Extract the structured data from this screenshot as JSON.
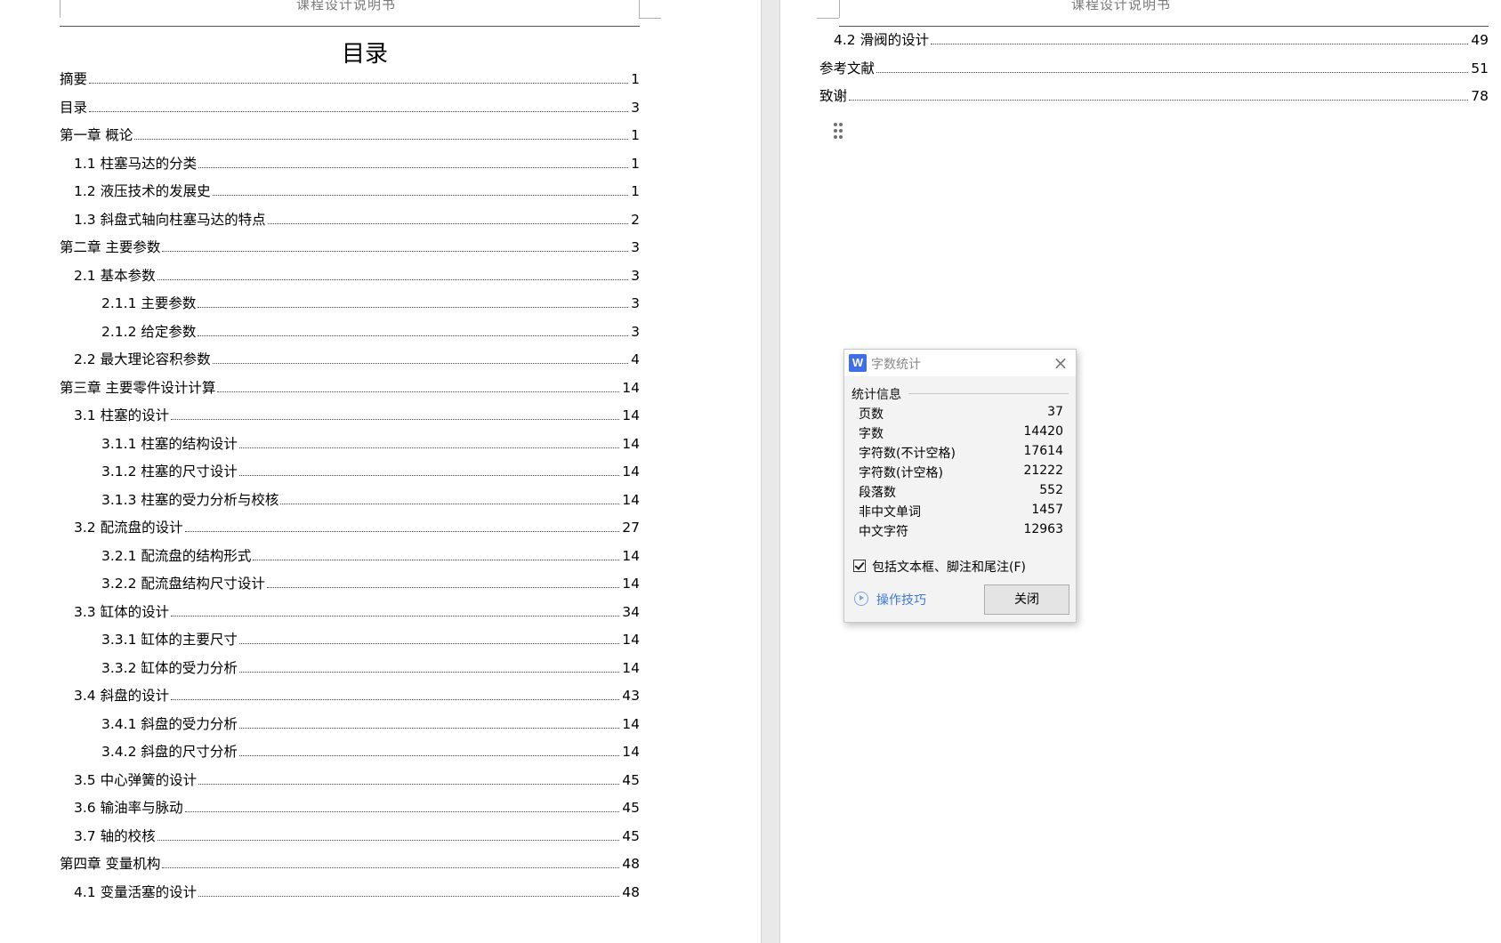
{
  "header": {
    "title": "课程设计说明书"
  },
  "toc": {
    "title": "目录",
    "left_entries": [
      {
        "label": "摘要",
        "page": "1",
        "level": 0
      },
      {
        "label": "目录",
        "page": "3",
        "level": 0
      },
      {
        "label": "第一章  概论",
        "page": "1",
        "level": 0
      },
      {
        "label": "1.1  柱塞马达的分类",
        "page": "1",
        "level": 1
      },
      {
        "label": "1.2  液压技术的发展史",
        "page": "1",
        "level": 1
      },
      {
        "label": "1.3  斜盘式轴向柱塞马达的特点",
        "page": "2",
        "level": 1
      },
      {
        "label": "第二章  主要参数",
        "page": "3",
        "level": 0
      },
      {
        "label": "2.1 基本参数",
        "page": "3",
        "level": 1
      },
      {
        "label": "2.1.1 主要参数",
        "page": "3",
        "level": 2
      },
      {
        "label": "2.1.2 给定参数",
        "page": "3",
        "level": 2
      },
      {
        "label": "2.2 最大理论容积参数",
        "page": "4",
        "level": 1
      },
      {
        "label": "第三章  主要零件设计计算",
        "page": "14",
        "level": 0
      },
      {
        "label": "3.1 柱塞的设计",
        "page": "14",
        "level": 1
      },
      {
        "label": "3.1.1 柱塞的结构设计",
        "page": "14",
        "level": 2
      },
      {
        "label": "3.1.2 柱塞的尺寸设计",
        "page": "14",
        "level": 2
      },
      {
        "label": "3.1.3 柱塞的受力分析与校核",
        "page": "14",
        "level": 2
      },
      {
        "label": "3.2 配流盘的设计",
        "page": "27",
        "level": 1
      },
      {
        "label": "3.2.1 配流盘的结构形式",
        "page": "14",
        "level": 2
      },
      {
        "label": "3.2.2 配流盘结构尺寸设计",
        "page": "14",
        "level": 2
      },
      {
        "label": "3.3 缸体的设计",
        "page": "34",
        "level": 1
      },
      {
        "label": "3.3.1 缸体的主要尺寸",
        "page": "14",
        "level": 2
      },
      {
        "label": "3.3.2 缸体的受力分析",
        "page": "14",
        "level": 2
      },
      {
        "label": "3.4 斜盘的设计",
        "page": "43",
        "level": 1
      },
      {
        "label": "3.4.1 斜盘的受力分析",
        "page": "14",
        "level": 2
      },
      {
        "label": "3.4.2 斜盘的尺寸分析",
        "page": "14",
        "level": 2
      },
      {
        "label": "3.5 中心弹簧的设计",
        "page": "45",
        "level": 1
      },
      {
        "label": "3.6 输油率与脉动",
        "page": "45",
        "level": 1
      },
      {
        "label": "3.7 轴的校核",
        "page": "45",
        "level": 1
      },
      {
        "label": "第四章  变量机构",
        "page": "48",
        "level": 0
      },
      {
        "label": "4.1  变量活塞的设计",
        "page": "48",
        "level": 1
      }
    ],
    "right_entries": [
      {
        "label": "4.2  滑阀的设计",
        "page": "49",
        "level": 1
      },
      {
        "label": "参考文献",
        "page": "51",
        "level": 0
      },
      {
        "label": "致谢",
        "page": "78",
        "level": 0
      }
    ]
  },
  "dialog": {
    "app_icon": "W",
    "title": "字数统计",
    "group_label": "统计信息",
    "stats": [
      {
        "label": "页数",
        "value": "37"
      },
      {
        "label": "字数",
        "value": "14420"
      },
      {
        "label": "字符数(不计空格)",
        "value": "17614"
      },
      {
        "label": "字符数(计空格)",
        "value": "21222"
      },
      {
        "label": "段落数",
        "value": "552"
      },
      {
        "label": "非中文单词",
        "value": "1457"
      },
      {
        "label": "中文字符",
        "value": "12963"
      }
    ],
    "checkbox_label": "包括文本框、脚注和尾注(F)",
    "checkbox_checked": true,
    "tips_link": "操作技巧",
    "close_button": "关闭",
    "close_icon": "close-icon"
  },
  "colors": {
    "app_icon_bg": "#3f6ee8",
    "link": "#3b7ad6",
    "page_gutter": "#e9e9e9"
  }
}
